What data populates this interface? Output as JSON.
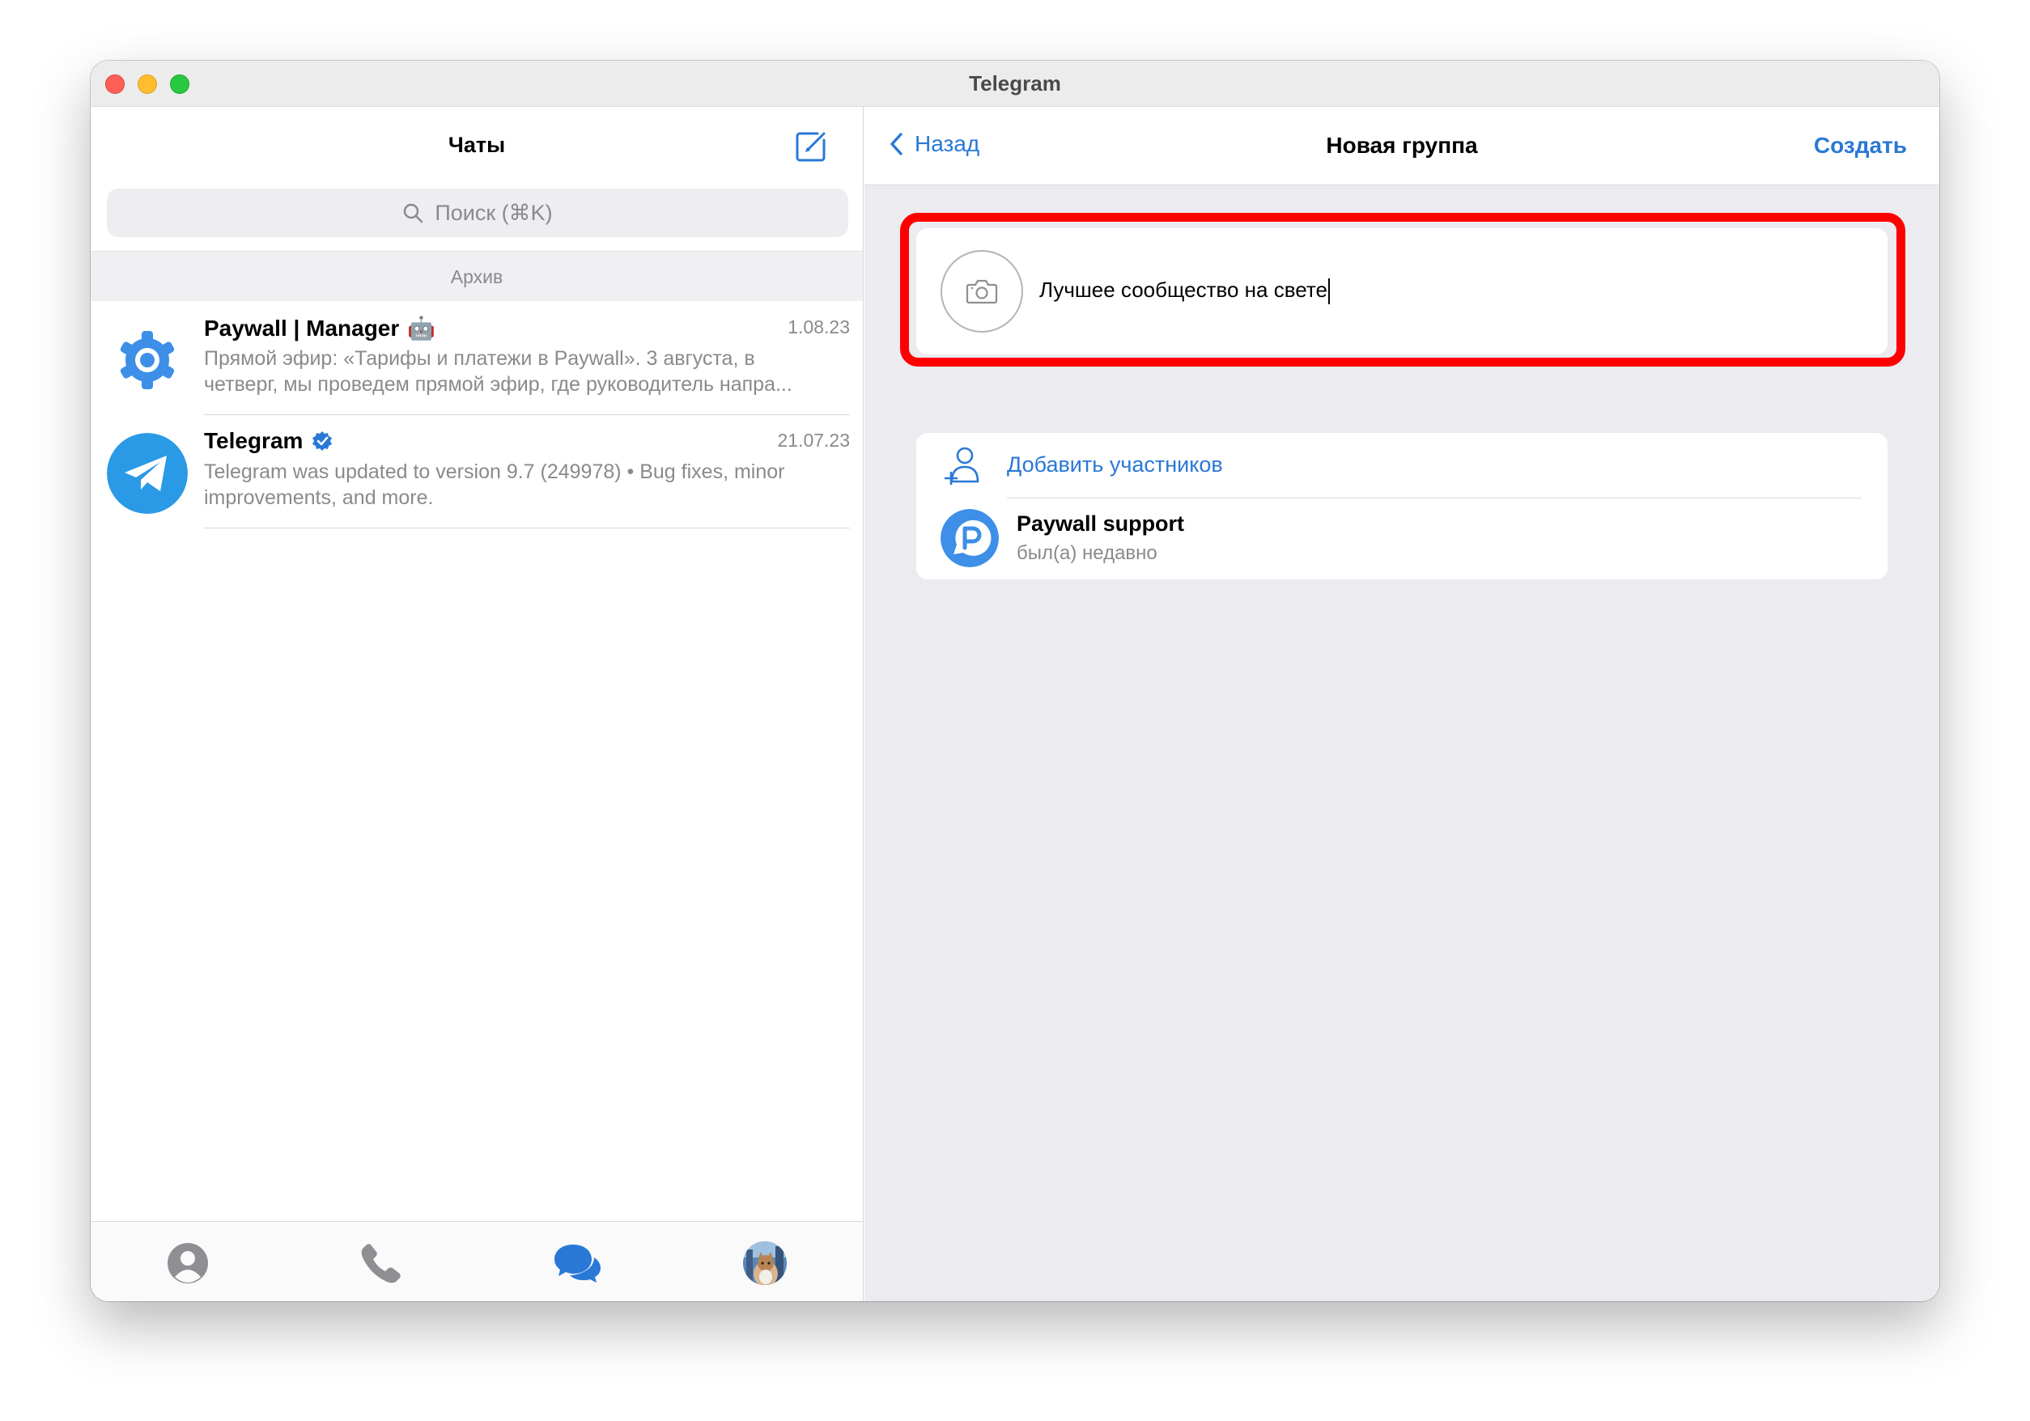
{
  "window": {
    "title": "Telegram"
  },
  "left": {
    "title": "Чаты",
    "search_placeholder": "Поиск (⌘K)",
    "archive_label": "Архив",
    "chats": [
      {
        "name": "Paywall | Manager",
        "emoji": "🤖",
        "date": "1.08.23",
        "preview_line1": "Прямой эфир: «Тарифы и платежи в Paywall».  3 августа, в",
        "preview_line2": "четверг, мы проведем прямой эфир, где руководитель напра...",
        "avatar_icon": "gear-avatar"
      },
      {
        "name": "Telegram",
        "date": "21.07.23",
        "preview_line1": "Telegram was updated to version 9.7 (249978)  • Bug fixes, minor",
        "preview_line2": "improvements, and more.",
        "avatar_icon": "telegram-logo",
        "verified": true
      }
    ],
    "tabs": [
      "contacts-icon",
      "calls-icon",
      "chats-icon",
      "profile-avatar"
    ]
  },
  "right": {
    "back_label": "Назад",
    "title": "Новая группа",
    "create_label": "Создать",
    "group_name_value": "Лучшее сообщество на свете",
    "add_members_label": "Добавить участников",
    "members": [
      {
        "name": "Paywall support",
        "status": "был(а) недавно"
      }
    ]
  },
  "colors": {
    "accent": "#2a78d6",
    "highlight": "#ff0000",
    "pane_bg": "#ececf0"
  }
}
